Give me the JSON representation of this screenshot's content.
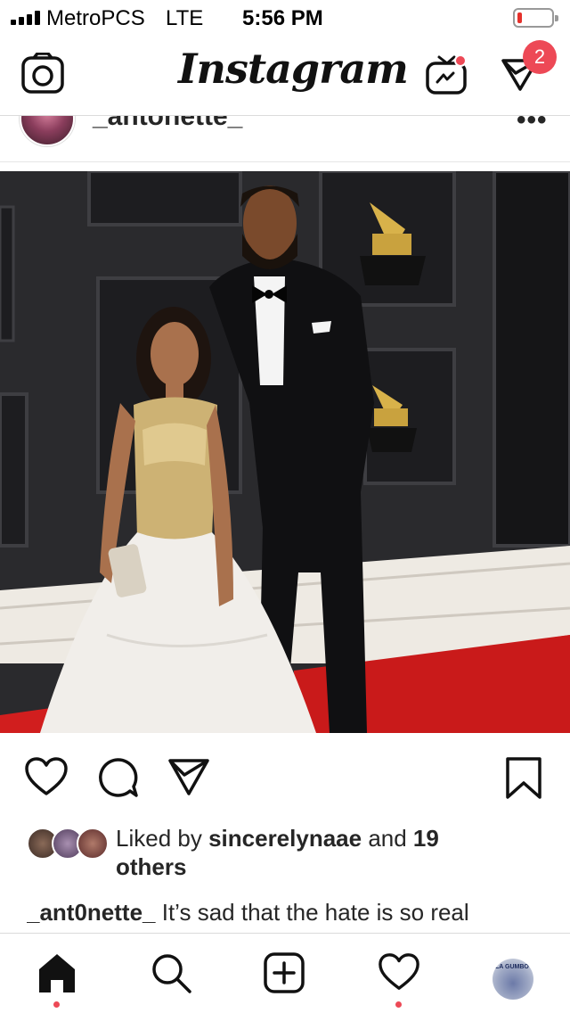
{
  "status_bar": {
    "carrier": "MetroPCS",
    "network": "LTE",
    "time": "5:56 PM",
    "signal_bars": 4,
    "battery_level": 0.12,
    "battery_color": "#e5312b"
  },
  "navbar": {
    "logo": "Instagram",
    "left_icon": "camera-icon",
    "tv_icon": "igtv-icon",
    "direct_icon": "direct-message-icon",
    "direct_badge": "2",
    "badge_color": "#ed4956"
  },
  "post": {
    "username": "_antonette_",
    "more_icon": "more-options-icon",
    "photo_alt_icon": "photo",
    "actions": {
      "like_icon": "heart-icon",
      "comment_icon": "comment-icon",
      "share_icon": "share-icon",
      "save_icon": "bookmark-icon"
    },
    "likes": {
      "prefix": "Liked by ",
      "liker": "sincerelynaae",
      "middle": " and ",
      "others": "19 others"
    },
    "caption": {
      "username": "_ant0nette_",
      "text": " It’s sad that the hate is so real"
    }
  },
  "tabbar": {
    "items": [
      "home-icon",
      "search-icon",
      "new-post-icon",
      "activity-icon",
      "profile-avatar"
    ],
    "profile_label": "LA GUMBO"
  }
}
